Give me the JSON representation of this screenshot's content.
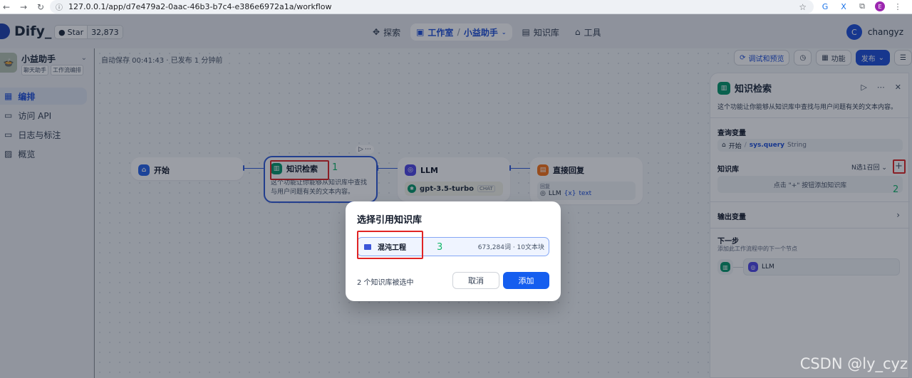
{
  "browser": {
    "url": "127.0.0.1/app/d7e479a2-0aac-46b3-b7c4-e386e6972a1a/workflow",
    "profile_initial": "E"
  },
  "header": {
    "logo": "Dify_",
    "github_star_label": "Star",
    "github_star_count": "32,873",
    "nav": {
      "explore": "探索",
      "studio": "工作室",
      "app_crumb": "小益助手",
      "knowledge": "知识库",
      "tools": "工具"
    },
    "user_initial": "C",
    "user_name": "changyz"
  },
  "sidebar": {
    "app_name": "小益助手",
    "tags": [
      "聊天助手",
      "工作流编排"
    ],
    "items": [
      {
        "label": "编排",
        "active": true
      },
      {
        "label": "访问 API"
      },
      {
        "label": "日志与标注"
      },
      {
        "label": "概览"
      }
    ]
  },
  "canvas": {
    "autosave": "自动保存 00:41:43 · 已发布 1 分钟前",
    "actions": {
      "debug": "调试和预览",
      "features": "功能",
      "publish": "发布"
    },
    "nodes": {
      "start": {
        "title": "开始"
      },
      "knowledge": {
        "title": "知识检索",
        "desc": "这个功能让你能够从知识库中查找与用户问题有关的文本内容。"
      },
      "llm": {
        "title": "LLM",
        "model": "gpt-3.5-turbo",
        "mode": "CHAT"
      },
      "answer": {
        "title": "直接回复",
        "reply_label": "回复",
        "reply_source": "LLM",
        "reply_var": "text"
      }
    },
    "annotations": {
      "one": "1",
      "two": "2",
      "three": "3"
    }
  },
  "panel": {
    "title": "知识检索",
    "desc": "这个功能让你能够从知识库中查找与用户问题有关的文本内容。",
    "query_label": "查询变量",
    "query_node": "开始",
    "query_var": "sys.query",
    "query_type": "String",
    "kb_label": "知识库",
    "kb_mode": "N选1召回",
    "kb_add": "+",
    "kb_empty": "点击 \"+\" 按钮添加知识库",
    "output_label": "输出变量",
    "next_label": "下一步",
    "next_desc": "添加此工作流程中的下一个节点",
    "next_target": "LLM"
  },
  "modal": {
    "title": "选择引用知识库",
    "kb_name": "混沌工程",
    "kb_meta": "673,284词 · 10文本块",
    "selected_count": "2 个知识库被选中",
    "cancel": "取消",
    "add": "添加"
  },
  "watermark": "CSDN @ly_cyz"
}
